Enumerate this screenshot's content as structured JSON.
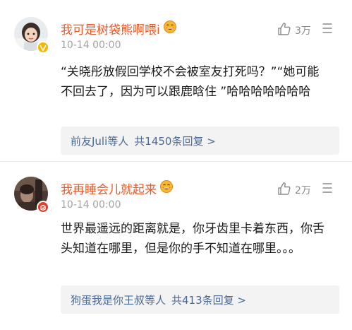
{
  "comments": [
    {
      "username": "我可是树袋熊啊喂i",
      "badge_icon": "grinning-emoji-icon",
      "timestamp": "10-14 00:00",
      "like_count": "3万",
      "text": "“关晓彤放假回学校不会被室友打死吗？”“她可能不回去了，因为可以跟鹿晗住 ”哈哈哈哈哈哈哈",
      "reply_names": "前友Juli等人",
      "reply_count": "共1450条回复 >"
    },
    {
      "username": "我再睡会儿就起来",
      "badge_icon": "grinning-emoji-icon",
      "timestamp": "10-14 00:00",
      "like_count": "2万",
      "text": "世界最遥远的距离就是，你牙齿里卡着东西，你舌头知道在哪里，但是你的手不知道在哪里。。。",
      "reply_names": "狗蛋我是你王叔等人",
      "reply_count": "共413条回复 >"
    }
  ],
  "colors": {
    "username": "#e85a28",
    "reply_link": "#4a6a96",
    "vip_badge": "#f5b800",
    "red_badge": "#e0402a"
  }
}
